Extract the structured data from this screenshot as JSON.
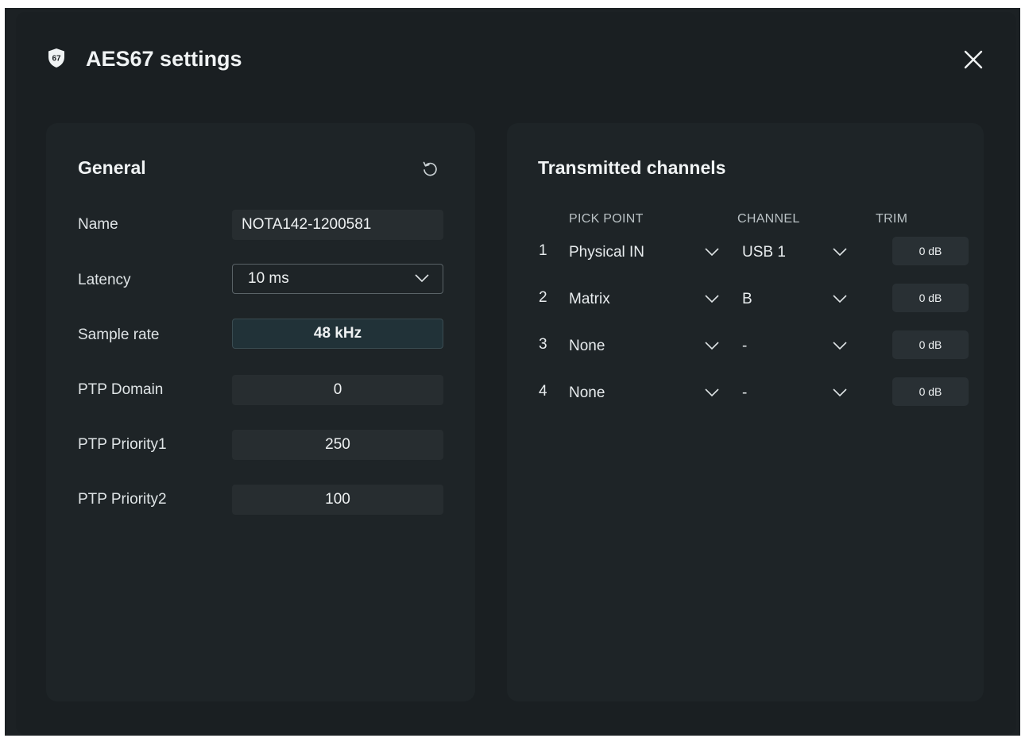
{
  "dialog": {
    "title": "AES67 settings"
  },
  "general": {
    "title": "General",
    "name": {
      "label": "Name",
      "value": "NOTA142-1200581"
    },
    "latency": {
      "label": "Latency",
      "value": "10 ms"
    },
    "sample_rate": {
      "label": "Sample rate",
      "value": "48 kHz"
    },
    "ptp_domain": {
      "label": "PTP Domain",
      "value": "0"
    },
    "ptp_priority1": {
      "label": "PTP Priority1",
      "value": "250"
    },
    "ptp_priority2": {
      "label": "PTP Priority2",
      "value": "100"
    }
  },
  "transmitted": {
    "title": "Transmitted channels",
    "headers": {
      "pick_point": "PICK POINT",
      "channel": "CHANNEL",
      "trim": "TRIM"
    },
    "rows": [
      {
        "num": "1",
        "pick_point": "Physical IN",
        "channel": "USB 1",
        "trim": "0 dB"
      },
      {
        "num": "2",
        "pick_point": "Matrix",
        "channel": "B",
        "trim": "0 dB"
      },
      {
        "num": "3",
        "pick_point": "None",
        "channel": "-",
        "trim": "0 dB"
      },
      {
        "num": "4",
        "pick_point": "None",
        "channel": "-",
        "trim": "0 dB"
      }
    ]
  },
  "icons": {
    "app": "shield-67-icon",
    "close": "close-icon",
    "reset": "reset-icon",
    "dropdown": "chevron-down-icon"
  },
  "colors": {
    "background": "#1a1f22",
    "panel": "#1e2427",
    "field": "#272d30",
    "sample_rate_field": "#213238"
  }
}
